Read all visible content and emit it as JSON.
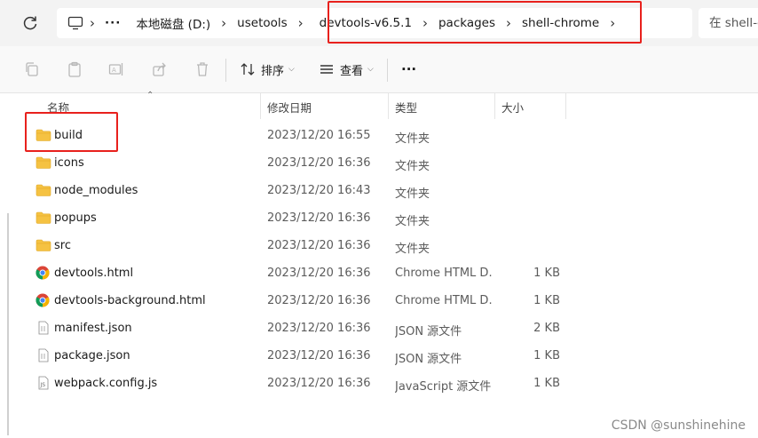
{
  "address": {
    "crumbs": [
      "本地磁盘 (D:)",
      "usetools",
      "devtools-v6.5.1",
      "packages",
      "shell-chrome"
    ],
    "search_placeholder": "在 shell-chrome 中搜索"
  },
  "toolbar": {
    "sort_label": "排序",
    "view_label": "查看",
    "more_label": "···"
  },
  "columns": {
    "name": "名称",
    "date": "修改日期",
    "type": "类型",
    "size": "大小"
  },
  "files": [
    {
      "name": "build",
      "date": "2023/12/20 16:55",
      "type": "文件夹",
      "size": "",
      "icon": "folder-icon"
    },
    {
      "name": "icons",
      "date": "2023/12/20 16:36",
      "type": "文件夹",
      "size": "",
      "icon": "folder-icon"
    },
    {
      "name": "node_modules",
      "date": "2023/12/20 16:43",
      "type": "文件夹",
      "size": "",
      "icon": "folder-icon"
    },
    {
      "name": "popups",
      "date": "2023/12/20 16:36",
      "type": "文件夹",
      "size": "",
      "icon": "folder-icon"
    },
    {
      "name": "src",
      "date": "2023/12/20 16:36",
      "type": "文件夹",
      "size": "",
      "icon": "folder-icon"
    },
    {
      "name": "devtools.html",
      "date": "2023/12/20 16:36",
      "type": "Chrome HTML D...",
      "size": "1 KB",
      "icon": "chrome-icon"
    },
    {
      "name": "devtools-background.html",
      "date": "2023/12/20 16:36",
      "type": "Chrome HTML D...",
      "size": "1 KB",
      "icon": "chrome-icon"
    },
    {
      "name": "manifest.json",
      "date": "2023/12/20 16:36",
      "type": "JSON 源文件",
      "size": "2 KB",
      "icon": "json-file-icon"
    },
    {
      "name": "package.json",
      "date": "2023/12/20 16:36",
      "type": "JSON 源文件",
      "size": "1 KB",
      "icon": "json-file-icon"
    },
    {
      "name": "webpack.config.js",
      "date": "2023/12/20 16:36",
      "type": "JavaScript 源文件",
      "size": "1 KB",
      "icon": "js-file-icon"
    }
  ],
  "watermark": "CSDN @sunshinehine",
  "colors": {
    "highlight": "#e8211d",
    "folder": "#f5c242",
    "background": "#ffffff"
  }
}
